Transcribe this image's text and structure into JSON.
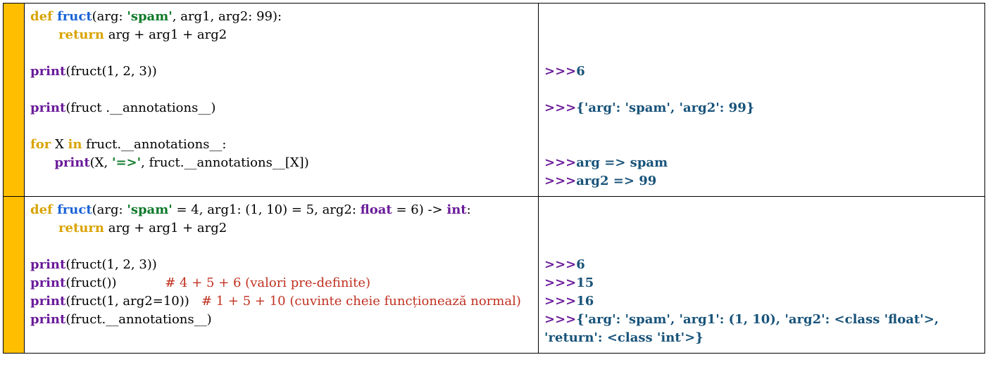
{
  "rows": [
    {
      "code": [
        [
          {
            "t": "def ",
            "c": "tk-def"
          },
          {
            "t": "fruct",
            "c": "tk-fn"
          },
          {
            "t": "(arg: ",
            "c": "tk-plain"
          },
          {
            "t": "'spam'",
            "c": "tk-str"
          },
          {
            "t": ", arg1, arg2: 99):",
            "c": "tk-plain"
          }
        ],
        [
          {
            "t": "       ",
            "c": "tk-plain"
          },
          {
            "t": "return",
            "c": "tk-def"
          },
          {
            "t": " arg + arg1 + arg2",
            "c": "tk-plain"
          }
        ],
        [],
        [
          {
            "t": "print",
            "c": "tk-call"
          },
          {
            "t": "(fruct(1, 2, 3))",
            "c": "tk-plain"
          }
        ],
        [],
        [
          {
            "t": "print",
            "c": "tk-call"
          },
          {
            "t": "(fruct .__annotations__)",
            "c": "tk-plain"
          }
        ],
        [],
        [
          {
            "t": "for",
            "c": "tk-def"
          },
          {
            "t": " X ",
            "c": "tk-plain"
          },
          {
            "t": "in",
            "c": "tk-def"
          },
          {
            "t": " fruct.__annotations__:",
            "c": "tk-plain"
          }
        ],
        [
          {
            "t": "      ",
            "c": "tk-plain"
          },
          {
            "t": "print",
            "c": "tk-call"
          },
          {
            "t": "(X, ",
            "c": "tk-plain"
          },
          {
            "t": "'=>'",
            "c": "tk-str"
          },
          {
            "t": ", fruct.__annotations__[X])",
            "c": "tk-plain"
          }
        ]
      ],
      "output": [
        [],
        [],
        [],
        [
          {
            "t": ">>>",
            "c": "out-prompt"
          },
          {
            "t": "6",
            "c": "out-text"
          }
        ],
        [],
        [
          {
            "t": ">>>",
            "c": "out-prompt"
          },
          {
            "t": "{'arg': 'spam', 'arg2': 99}",
            "c": "out-text"
          }
        ],
        [],
        [],
        [
          {
            "t": ">>>",
            "c": "out-prompt"
          },
          {
            "t": "arg => spam",
            "c": "out-text"
          }
        ],
        [
          {
            "t": ">>>",
            "c": "out-prompt"
          },
          {
            "t": "arg2 => 99",
            "c": "out-text"
          }
        ]
      ]
    },
    {
      "code": [
        [
          {
            "t": "def ",
            "c": "tk-def"
          },
          {
            "t": "fruct",
            "c": "tk-fn"
          },
          {
            "t": "(arg: ",
            "c": "tk-plain"
          },
          {
            "t": "'spam'",
            "c": "tk-str"
          },
          {
            "t": " = 4, arg1: (1, 10) = 5, arg2: ",
            "c": "tk-plain"
          },
          {
            "t": "float",
            "c": "tk-call"
          },
          {
            "t": " = 6) -> ",
            "c": "tk-plain"
          },
          {
            "t": "int",
            "c": "tk-call"
          },
          {
            "t": ":",
            "c": "tk-plain"
          }
        ],
        [
          {
            "t": "       ",
            "c": "tk-plain"
          },
          {
            "t": "return",
            "c": "tk-def"
          },
          {
            "t": " arg + arg1 + arg2",
            "c": "tk-plain"
          }
        ],
        [],
        [
          {
            "t": "print",
            "c": "tk-call"
          },
          {
            "t": "(fruct(1, 2, 3))",
            "c": "tk-plain"
          }
        ],
        [
          {
            "t": "print",
            "c": "tk-call"
          },
          {
            "t": "(fruct())            ",
            "c": "tk-plain"
          },
          {
            "t": "# 4 + 5 + 6 (valori pre-definite)",
            "c": "tk-cmt"
          }
        ],
        [
          {
            "t": "print",
            "c": "tk-call"
          },
          {
            "t": "(fruct(1, arg2=10))   ",
            "c": "tk-plain"
          },
          {
            "t": "# 1 + 5 + 10 (cuvinte cheie funcționează normal)",
            "c": "tk-cmt"
          }
        ],
        [
          {
            "t": "print",
            "c": "tk-call"
          },
          {
            "t": "(fruct.__annotations__)",
            "c": "tk-plain"
          }
        ]
      ],
      "output": [
        [],
        [],
        [],
        [
          {
            "t": ">>>",
            "c": "out-prompt"
          },
          {
            "t": "6",
            "c": "out-text"
          }
        ],
        [
          {
            "t": ">>>",
            "c": "out-prompt"
          },
          {
            "t": "15",
            "c": "out-text"
          }
        ],
        [
          {
            "t": ">>>",
            "c": "out-prompt"
          },
          {
            "t": "16",
            "c": "out-text"
          }
        ],
        [
          {
            "t": ">>>",
            "c": "out-prompt"
          },
          {
            "t": "{'arg': 'spam', 'arg1': (1, 10), 'arg2': <class 'float'>, 'return': <class 'int'>}",
            "c": "out-text"
          }
        ]
      ]
    }
  ]
}
